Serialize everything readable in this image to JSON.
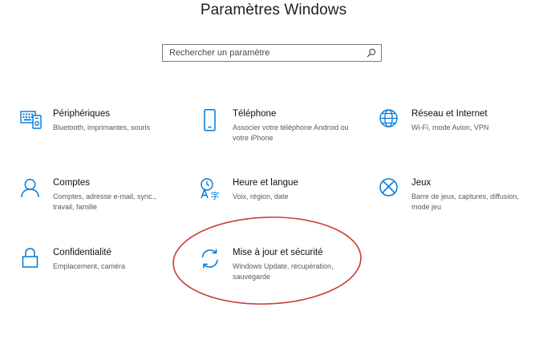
{
  "window": {
    "title": "Paramètres Windows"
  },
  "search": {
    "placeholder": "Rechercher un paramètre",
    "icon": "search-icon"
  },
  "categories": [
    {
      "name": "Périphériques",
      "desc": "Bluetooth, imprimantes, souris",
      "icon": "devices-icon"
    },
    {
      "name": "Téléphone",
      "desc": "Associer votre téléphone Android ou votre iPhone",
      "icon": "phone-icon"
    },
    {
      "name": "Réseau et Internet",
      "desc": "Wi-Fi, mode Avion, VPN",
      "icon": "globe-icon"
    },
    {
      "name": "Comptes",
      "desc": "Comptes, adresse e-mail, sync., travail, famille",
      "icon": "person-icon"
    },
    {
      "name": "Heure et langue",
      "desc": "Voix, région, date",
      "icon": "time-language-icon"
    },
    {
      "name": "Jeux",
      "desc": "Barre de jeux, captures, diffusion, mode jeu",
      "icon": "xbox-icon"
    },
    {
      "name": "Confidentialité",
      "desc": "Emplacement, caméra",
      "icon": "lock-icon"
    },
    {
      "name": "Mise à jour et sécurité",
      "desc": "Windows Update, récupération, sauvegarde",
      "icon": "sync-icon"
    }
  ],
  "colors": {
    "accent": "#0078d7",
    "annotation": "#c8403a"
  }
}
